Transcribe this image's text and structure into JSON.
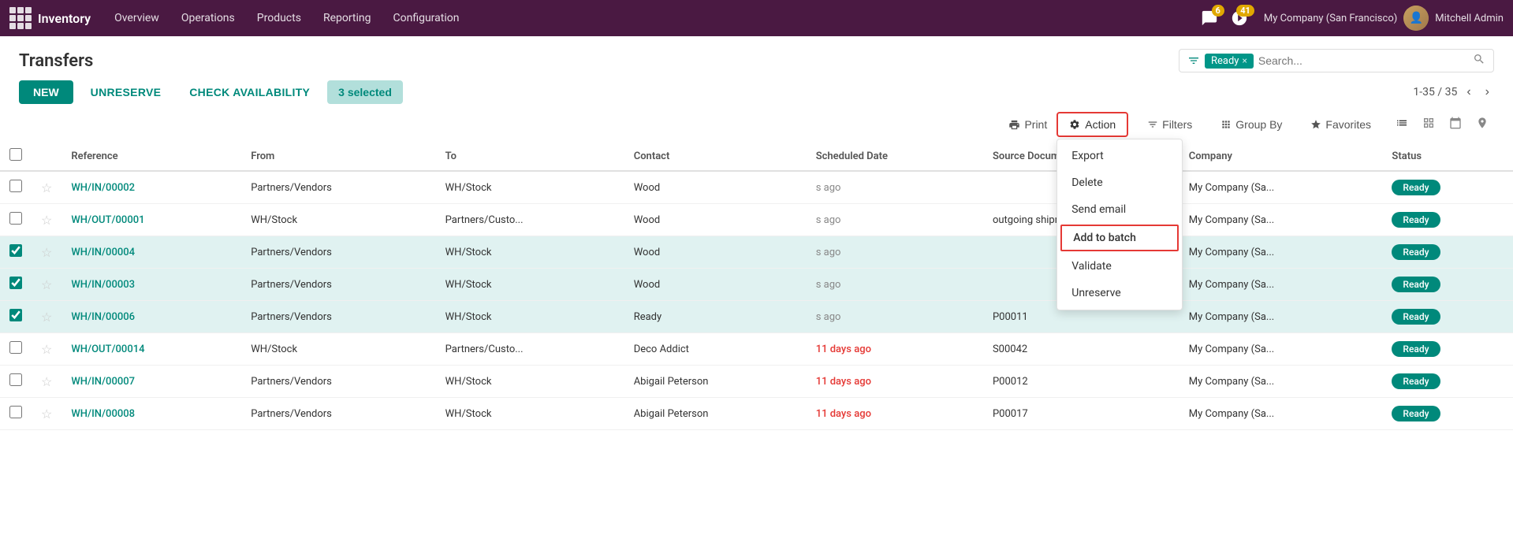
{
  "app": {
    "name": "Inventory",
    "nav_links": [
      "Overview",
      "Operations",
      "Products",
      "Reporting",
      "Configuration"
    ],
    "messages_count": "6",
    "activity_count": "41",
    "company": "My Company (San Francisco)",
    "user": "Mitchell Admin"
  },
  "page": {
    "title": "Transfers",
    "search": {
      "filter_tag": "Ready",
      "placeholder": "Search..."
    },
    "pagination": "1-35 / 35",
    "selected_label": "3 selected"
  },
  "toolbar": {
    "new_label": "NEW",
    "unreserve_label": "UNRESERVE",
    "check_avail_label": "CHECK AVAILABILITY",
    "filters_label": "Filters",
    "group_by_label": "Group By",
    "favorites_label": "Favorites",
    "print_label": "Print",
    "action_label": "Action"
  },
  "action_menu": {
    "items": [
      {
        "label": "Export",
        "highlighted": false
      },
      {
        "label": "Delete",
        "highlighted": false
      },
      {
        "label": "Send email",
        "highlighted": false
      },
      {
        "label": "Add to batch",
        "highlighted": true
      },
      {
        "label": "Validate",
        "highlighted": false
      },
      {
        "label": "Unreserve",
        "highlighted": false
      }
    ]
  },
  "table": {
    "columns": [
      "",
      "",
      "Reference",
      "From",
      "To",
      "Contact",
      "Scheduled Date",
      "Source Document",
      "Company",
      "Status"
    ],
    "rows": [
      {
        "id": "row1",
        "checked": false,
        "starred": false,
        "selected": false,
        "ref": "WH/IN/00002",
        "from": "Partners/Vendors",
        "to": "WH/Stock",
        "contact": "Wood",
        "date": "s ago",
        "date_red": false,
        "source": "",
        "company": "My Company (Sa...",
        "status": "Ready"
      },
      {
        "id": "row2",
        "checked": false,
        "starred": false,
        "selected": false,
        "ref": "WH/OUT/00001",
        "from": "WH/Stock",
        "to": "Partners/Custo...",
        "contact": "Wood",
        "date": "s ago",
        "date_red": false,
        "source": "outgoing shipm...",
        "company": "My Company (Sa...",
        "status": "Ready"
      },
      {
        "id": "row3",
        "checked": true,
        "starred": false,
        "selected": true,
        "ref": "WH/IN/00004",
        "from": "Partners/Vendors",
        "to": "WH/Stock",
        "contact": "Wood",
        "date": "s ago",
        "date_red": false,
        "source": "",
        "company": "My Company (Sa...",
        "status": "Ready"
      },
      {
        "id": "row4",
        "checked": true,
        "starred": false,
        "selected": true,
        "ref": "WH/IN/00003",
        "from": "Partners/Vendors",
        "to": "WH/Stock",
        "contact": "Wood",
        "date": "s ago",
        "date_red": false,
        "source": "",
        "company": "My Company (Sa...",
        "status": "Ready"
      },
      {
        "id": "row5",
        "checked": true,
        "starred": false,
        "selected": true,
        "ref": "WH/IN/00006",
        "from": "Partners/Vendors",
        "to": "WH/Stock",
        "contact": "Ready",
        "date": "s ago",
        "date_red": false,
        "source": "P00011",
        "company": "My Company (Sa...",
        "status": "Ready"
      },
      {
        "id": "row6",
        "checked": false,
        "starred": false,
        "selected": false,
        "ref": "WH/OUT/00014",
        "from": "WH/Stock",
        "to": "Partners/Custo...",
        "contact": "Deco Addict",
        "date": "11 days ago",
        "date_red": true,
        "source": "S00042",
        "company": "My Company (Sa...",
        "status": "Ready"
      },
      {
        "id": "row7",
        "checked": false,
        "starred": false,
        "selected": false,
        "ref": "WH/IN/00007",
        "from": "Partners/Vendors",
        "to": "WH/Stock",
        "contact": "Abigail Peterson",
        "date": "11 days ago",
        "date_red": true,
        "source": "P00012",
        "company": "My Company (Sa...",
        "status": "Ready"
      },
      {
        "id": "row8",
        "checked": false,
        "starred": false,
        "selected": false,
        "ref": "WH/IN/00008",
        "from": "Partners/Vendors",
        "to": "WH/Stock",
        "contact": "Abigail Peterson",
        "date": "11 days ago",
        "date_red": true,
        "source": "P00017",
        "company": "My Company (Sa...",
        "status": "Ready"
      }
    ]
  }
}
